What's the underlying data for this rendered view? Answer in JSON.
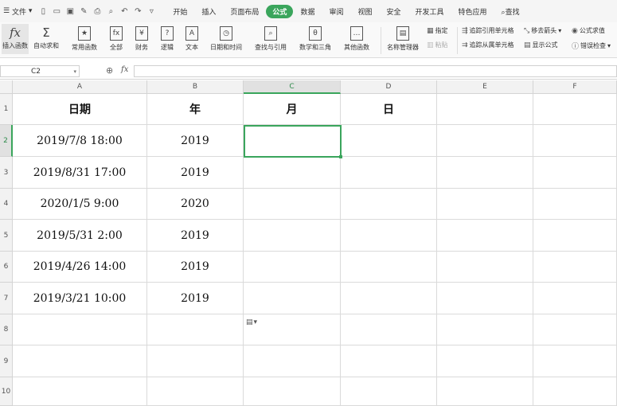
{
  "menubar": {
    "file_label": "文件",
    "tabs": [
      "开始",
      "插入",
      "页面布局",
      "公式",
      "数据",
      "审阅",
      "视图",
      "安全",
      "开发工具",
      "特色应用",
      "查找"
    ],
    "active_tab": "公式"
  },
  "ribbon": {
    "insert_function": "插入函数",
    "autosum": "自动求和",
    "common_functions": "常用函数",
    "all": "全部",
    "finance": "财务",
    "logic": "逻辑",
    "text": "文本",
    "datetime": "日期和时间",
    "lookup": "查找与引用",
    "math": "数学和三角",
    "other": "其他函数",
    "name_manager": "名称管理器",
    "define": "指定",
    "paste": "粘贴",
    "trace_precedents": "追踪引用单元格",
    "trace_dependents": "追踪从属单元格",
    "remove_arrows": "移去箭头",
    "show_formulas": "显示公式",
    "evaluate": "公式求值",
    "error_check": "错误检查"
  },
  "formula_bar": {
    "name_box": "C2",
    "fx": "fx",
    "value": ""
  },
  "columns": [
    "A",
    "B",
    "C",
    "D",
    "E",
    "F"
  ],
  "rows": [
    "1",
    "2",
    "3",
    "4",
    "5",
    "6",
    "7",
    "8",
    "9",
    "10"
  ],
  "sheet": {
    "headers": [
      "日期",
      "年",
      "月",
      "日"
    ],
    "data": [
      [
        "2019/7/8  18:00",
        "2019"
      ],
      [
        "2019/8/31  17:00",
        "2019"
      ],
      [
        "2020/1/5  9:00",
        "2020"
      ],
      [
        "2019/5/31  2:00",
        "2019"
      ],
      [
        "2019/4/26  14:00",
        "2019"
      ],
      [
        "2019/3/21  10:00",
        "2019"
      ]
    ]
  },
  "selection": "C2"
}
